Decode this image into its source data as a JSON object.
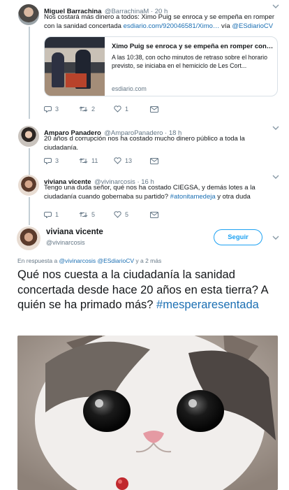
{
  "thread": [
    {
      "name": "Miguel Barrachina",
      "handle": "@BarrachinaM · 20 h",
      "text_plain": "Nos costará más dinero a todos: Ximo Puig se enroca y se empeña en romper con la sanidad concertada ",
      "text_link": "esdiario.com/920046581/Ximo…",
      "text_via": " vía ",
      "text_mention": "@ESdiarioCV",
      "card": {
        "title": "Ximo Puig se enroca y se empeña en romper con l...",
        "description": "A las 10:38, con ocho minutos de retraso sobre el horario previsto, se iniciaba en el hemiciclo de Les Cort...",
        "domain": "esdiario.com"
      },
      "replies": "3",
      "retweets": "2",
      "likes": "1"
    },
    {
      "name": "Amparo Panadero",
      "handle": "@AmparoPanadero · 18 h",
      "text_plain": "20 años d corrupción nos ha costado mucho dinero público a toda la ciudadanía.",
      "replies": "3",
      "retweets": "11",
      "likes": "13"
    },
    {
      "name": "viviana vicente",
      "handle": "@vivinarcosis · 16 h",
      "text_plain": "Tengo una duda señor, qué nos ha costado CIEGSA, y demás lotes a la ciudadanía cuando gobernaba su partido? ",
      "text_hashtag": "#atonitamedeja",
      "text_after": " y otra duda",
      "replies": "1",
      "retweets": "5",
      "likes": "5"
    }
  ],
  "main_tweet": {
    "name": "viviana vicente",
    "handle": "@vivinarcosis",
    "follow_label": "Seguir",
    "reply_prefix": "En respuesta a ",
    "reply_mentions": "@vivinarcosis @ESdiarioCV",
    "reply_suffix": " y a 2 más",
    "text": "Qué nos cuesta a la ciudadanía la sanidad concertada desde hace 20 años en esta tierra? A quién se ha primado más?",
    "hashtag": "#mesperaresentada"
  },
  "icons": {
    "reply": "reply-icon",
    "retweet": "retweet-icon",
    "like": "heart-icon",
    "dm": "envelope-icon",
    "more": "chevron-down-icon"
  },
  "colors": {
    "link": "#1b6fb3",
    "follow": "#1da1f2",
    "muted": "#657786",
    "thread_line": "#c4cfd6"
  }
}
